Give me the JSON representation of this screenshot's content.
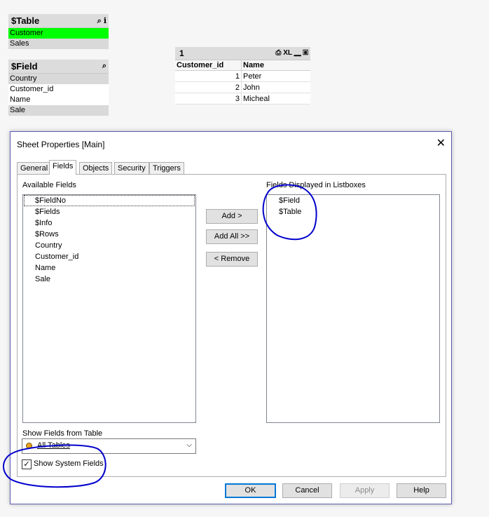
{
  "table_listbox": {
    "title": "$Table",
    "items": [
      "Customer",
      "Sales"
    ]
  },
  "field_listbox": {
    "title": "$Field",
    "items": [
      "Country",
      "Customer_id",
      "Name",
      "Sale"
    ]
  },
  "table_box": {
    "title": "1",
    "icon_xl": "XL",
    "columns": [
      "Customer_id",
      "Name"
    ],
    "rows": [
      {
        "id": "1",
        "name": "Peter"
      },
      {
        "id": "2",
        "name": "John"
      },
      {
        "id": "3",
        "name": "Micheal"
      }
    ]
  },
  "dialog": {
    "title": "Sheet Properties [Main]",
    "tabs": [
      "General",
      "Fields",
      "Objects",
      "Security",
      "Triggers"
    ],
    "available_label": "Available Fields",
    "available_fields": [
      "$FieldNo",
      "$Fields",
      "$Info",
      "$Rows",
      "Country",
      "Customer_id",
      "Name",
      "Sale"
    ],
    "displayed_label": "Fields Displayed in Listboxes",
    "displayed_fields": [
      "$Field",
      "$Table"
    ],
    "add_label": "Add >",
    "add_all_label": "Add All >>",
    "remove_label": "< Remove",
    "show_from_label": "Show Fields from Table",
    "show_from_value": "All Tables",
    "show_system_label": "Show System Fields",
    "ok_label": "OK",
    "cancel_label": "Cancel",
    "apply_label": "Apply",
    "help_label": "Help"
  },
  "colors": {
    "selected": "#00ff00",
    "annotation": "#0000cc"
  }
}
